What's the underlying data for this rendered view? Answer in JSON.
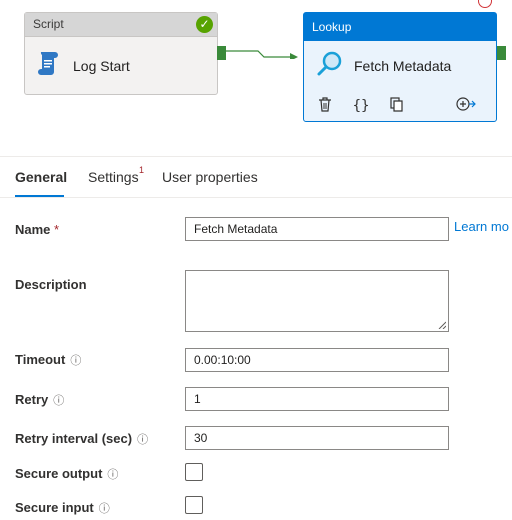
{
  "canvas": {
    "script_node": {
      "header": "Script",
      "label": "Log Start"
    },
    "lookup_node": {
      "header": "Lookup",
      "label": "Fetch Metadata"
    }
  },
  "tabs": [
    {
      "label": "General"
    },
    {
      "label": "Settings",
      "badge": "1"
    },
    {
      "label": "User properties"
    }
  ],
  "form": {
    "name_label": "Name",
    "name_required": "*",
    "name_value": "Fetch Metadata",
    "learn_more": "Learn mo",
    "description_label": "Description",
    "description_value": "",
    "timeout_label": "Timeout",
    "timeout_value": "0.00:10:00",
    "retry_label": "Retry",
    "retry_value": "1",
    "retry_interval_label": "Retry interval (sec)",
    "retry_interval_value": "30",
    "secure_output_label": "Secure output",
    "secure_output_checked": false,
    "secure_input_label": "Secure input",
    "secure_input_checked": false
  },
  "colors": {
    "accent": "#0078d4",
    "success": "#57a300",
    "required": "#a4262c"
  },
  "icons": [
    "script-icon",
    "check-icon",
    "search-icon",
    "delete-icon",
    "code-icon",
    "copy-icon",
    "add-output-icon",
    "info-icon"
  ]
}
